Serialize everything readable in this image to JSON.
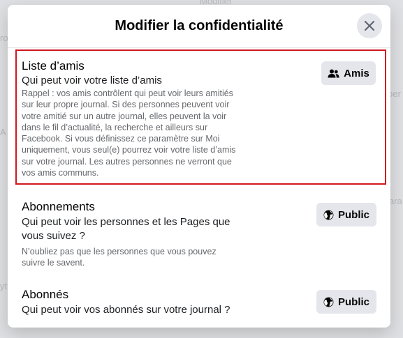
{
  "background": {
    "left_fragment_1": "ro",
    "left_fragment_2": "A",
    "left_fragment_3": "yt",
    "right_fragment_1": "per",
    "right_fragment_2": "ara",
    "top_fragment": "Modifier"
  },
  "modal": {
    "title": "Modifier la confidentialité",
    "close_icon": "close-icon"
  },
  "sections": [
    {
      "title": "Liste d’amis",
      "subtitle": "Qui peut voir votre liste d’amis",
      "note": "Rappel : vos amis contrôlent qui peut voir leurs amitiés sur leur propre journal. Si des personnes peuvent voir votre amitié sur un autre journal, elles peuvent la voir dans le fil d’actualité, la recherche et ailleurs sur Facebook. Si vous définissez ce paramètre sur Moi uniquement, vous seul(e) pourrez voir votre liste d’amis sur votre journal. Les autres personnes ne verront que vos amis communs.",
      "audience_label": "Amis",
      "audience_icon": "friends-icon"
    },
    {
      "title": "Abonnements",
      "subtitle": "Qui peut voir les personnes et les Pages que vous suivez ?",
      "note": "N’oubliez pas que les personnes que vous pouvez suivre le savent.",
      "audience_label": "Public",
      "audience_icon": "globe-icon"
    },
    {
      "title": "Abonnés",
      "subtitle": "Qui peut voir vos abonnés sur votre journal ?",
      "audience_label": "Public",
      "audience_icon": "globe-icon"
    }
  ],
  "colors": {
    "highlight_border": "#d1171c",
    "button_bg": "#e4e6eb",
    "secondary_text": "#65676b"
  }
}
